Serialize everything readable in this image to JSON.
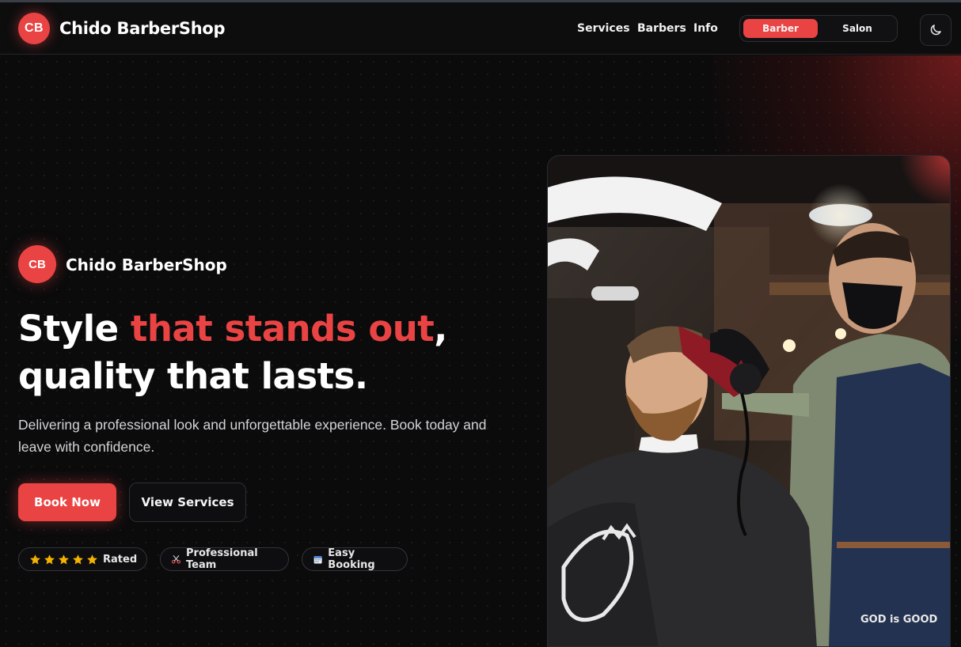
{
  "nav": {
    "logo_initials": "CB",
    "brand": "Chido BarberShop",
    "links": [
      "Services",
      "Barbers",
      "Info"
    ],
    "toggle": {
      "barber": "Barber",
      "salon": "Salon"
    },
    "theme_icon": "moon-icon"
  },
  "hero": {
    "logo_initials": "CB",
    "brand": "Chido BarberShop",
    "headline": {
      "part1": "Style ",
      "accent": "that stands out",
      "part2": ",",
      "line2": "quality that lasts."
    },
    "subtext": "Delivering a professional look and unforgettable experience. Book today and leave with confidence.",
    "primary_button": "Book Now",
    "secondary_button": "View Services",
    "badges": {
      "rated": "Rated",
      "team": "Professional Team",
      "booking": "Easy Booking"
    },
    "rating_stars": 5,
    "photo_apron_text": "GOD is GOOD"
  },
  "colors": {
    "accent": "#ea4343",
    "background": "#0b0b0c",
    "star": "#f5b301"
  }
}
